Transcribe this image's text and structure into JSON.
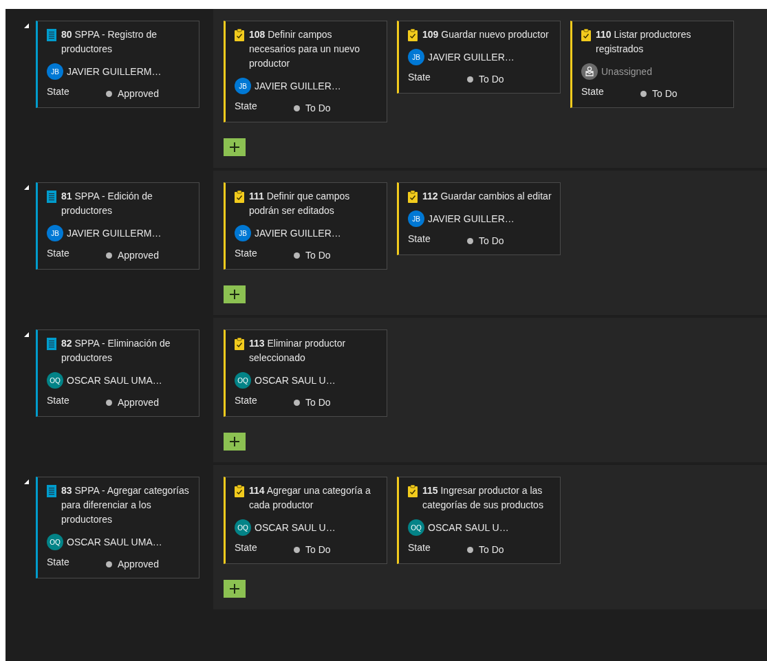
{
  "rows": [
    {
      "expanded": true,
      "parent": {
        "kind": "requirement",
        "title": "**80** SPPA - Registro de productores",
        "assignee": {
          "kind": "person",
          "initials": "JB",
          "name": "JAVIER GUILLERM…",
          "color": "#0078d4"
        },
        "state_label": "State",
        "state": "Approved"
      },
      "tasks": [
        {
          "kind": "task",
          "title": "**108** Definir campos necesarios para un nuevo productor",
          "assignee": {
            "kind": "person",
            "initials": "JB",
            "name": "JAVIER GUILLER…",
            "color": "#0078d4"
          },
          "state_label": "State",
          "state": "To Do"
        },
        {
          "kind": "task",
          "title": "**109** Guardar nuevo productor",
          "assignee": {
            "kind": "person",
            "initials": "JB",
            "name": "JAVIER GUILLER…",
            "color": "#0078d4"
          },
          "state_label": "State",
          "state": "To Do"
        },
        {
          "kind": "task",
          "title": "**110** Listar productores registrados",
          "assignee": {
            "kind": "unassigned",
            "name": "Unassigned"
          },
          "state_label": "State",
          "state": "To Do"
        }
      ]
    },
    {
      "expanded": true,
      "parent": {
        "kind": "requirement",
        "title": "**81** SPPA - Edición de productores",
        "assignee": {
          "kind": "person",
          "initials": "JB",
          "name": "JAVIER GUILLERM…",
          "color": "#0078d4"
        },
        "state_label": "State",
        "state": "Approved"
      },
      "tasks": [
        {
          "kind": "task",
          "title": "**111** Definir que campos podrán ser editados",
          "assignee": {
            "kind": "person",
            "initials": "JB",
            "name": "JAVIER GUILLER…",
            "color": "#0078d4"
          },
          "state_label": "State",
          "state": "To Do"
        },
        {
          "kind": "task",
          "title": "**112** Guardar cambios al editar",
          "assignee": {
            "kind": "person",
            "initials": "JB",
            "name": "JAVIER GUILLER…",
            "color": "#0078d4"
          },
          "state_label": "State",
          "state": "To Do"
        }
      ]
    },
    {
      "expanded": true,
      "parent": {
        "kind": "requirement",
        "title": "**82** SPPA - Eliminación de productores",
        "assignee": {
          "kind": "person",
          "initials": "OQ",
          "name": "OSCAR SAUL UMA…",
          "color": "#038387"
        },
        "state_label": "State",
        "state": "Approved"
      },
      "tasks": [
        {
          "kind": "task",
          "title": "**113** Eliminar productor seleccionado",
          "assignee": {
            "kind": "person",
            "initials": "OQ",
            "name": "OSCAR SAUL U…",
            "color": "#038387"
          },
          "state_label": "State",
          "state": "To Do"
        }
      ]
    },
    {
      "expanded": true,
      "parent": {
        "kind": "requirement",
        "title": "**83** SPPA - Agregar categorías para diferenciar a los productores",
        "assignee": {
          "kind": "person",
          "initials": "OQ",
          "name": "OSCAR SAUL UMA…",
          "color": "#038387"
        },
        "state_label": "State",
        "state": "Approved"
      },
      "tasks": [
        {
          "kind": "task",
          "title": "**114** Agregar una categoría a cada productor",
          "assignee": {
            "kind": "person",
            "initials": "OQ",
            "name": "OSCAR SAUL U…",
            "color": "#038387"
          },
          "state_label": "State",
          "state": "To Do"
        },
        {
          "kind": "task",
          "title": "**115** Ingresar productor a las categorías de sus productos",
          "assignee": {
            "kind": "person",
            "initials": "OQ",
            "name": "OSCAR SAUL U…",
            "color": "#038387"
          },
          "state_label": "State",
          "state": "To Do"
        }
      ]
    }
  ]
}
